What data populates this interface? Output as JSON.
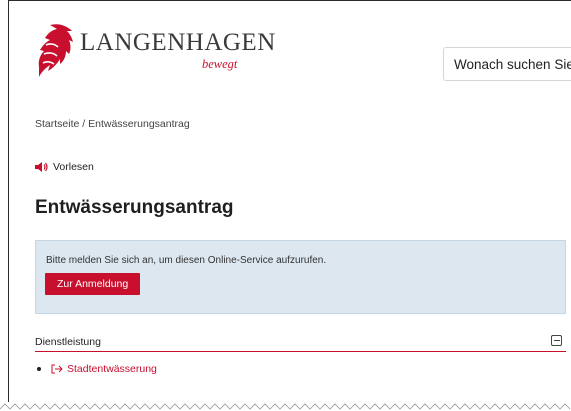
{
  "header": {
    "logo_word": "LANGENHAGEN",
    "logo_tagline": "bewegt",
    "search_placeholder": "Wonach suchen Sie?"
  },
  "breadcrumb": {
    "home": "Startseite",
    "separator": " / ",
    "current": "Entwässerungsantrag"
  },
  "read_aloud": {
    "label": "Vorlesen",
    "icon": "speaker-icon"
  },
  "page_title": "Entwässerungsantrag",
  "login_notice": {
    "message": "Bitte melden Sie sich an, um diesen Online-Service aufzurufen.",
    "button_label": "Zur Anmeldung"
  },
  "accordion": {
    "label": "Dienstleistung",
    "toggle_icon": "minus-square-icon"
  },
  "services": [
    {
      "label": "Stadtentwässerung",
      "icon": "external-link-icon"
    }
  ],
  "colors": {
    "brand_red": "#c8102e",
    "notice_bg": "#dce7f0",
    "text": "#1f1f1f"
  }
}
